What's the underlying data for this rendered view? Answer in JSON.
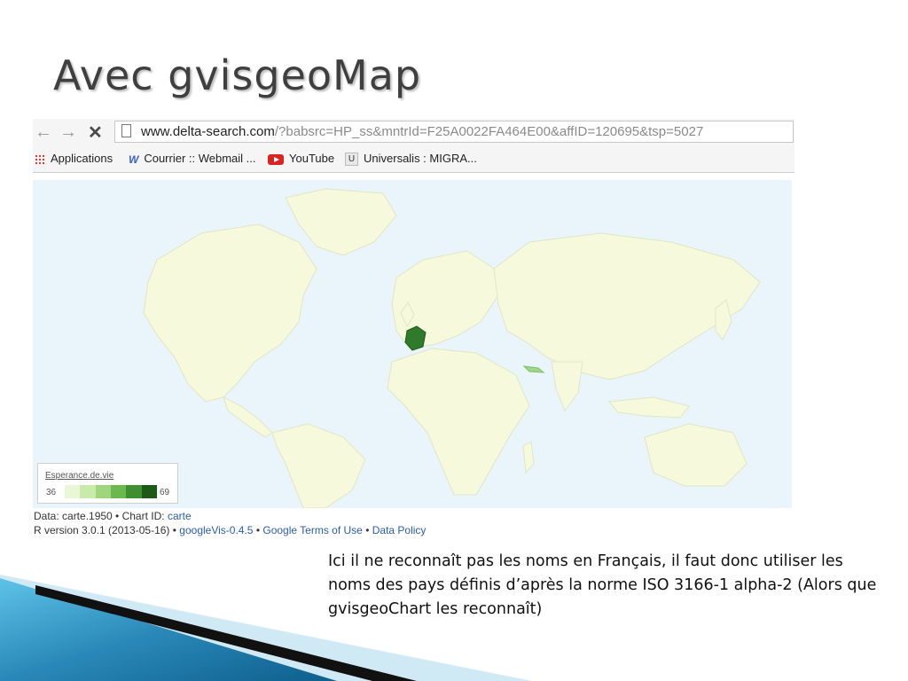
{
  "slide": {
    "title": "Avec gvisgeoMap",
    "note": "Ici il ne reconnaît pas les noms en Français, il faut donc utiliser les noms des pays définis d’après la norme ISO 3166-1 alpha-2 (Alors que gvisgeoChart les reconnaît)"
  },
  "browser": {
    "url_host": "www.delta-search.com",
    "url_rest": "/?babsrc=HP_ss&mntrId=F25A0022FA464E00&affID=120695&tsp=5027",
    "bookmarks": [
      {
        "label": "Applications",
        "icon": "apps-grid-icon"
      },
      {
        "label": "Courrier :: Webmail ...",
        "icon": "w-icon"
      },
      {
        "label": "YouTube",
        "icon": "youtube-icon"
      },
      {
        "label": "Universalis : MIGRA...",
        "icon": "u-icon"
      }
    ]
  },
  "map": {
    "legend_title": "Esperance.de.vie",
    "legend_min": "36",
    "legend_max": "69",
    "colors": {
      "ocean": "#eaf4fb",
      "land": "#f6f9dc",
      "border": "#dfe7c3",
      "france": "#2f7a2b",
      "low": "#e3f4c8",
      "high": "#1e5a17"
    }
  },
  "caption": {
    "line1_prefix": "Data: carte.1950 • Chart ID: ",
    "line1_link": "carte",
    "line2_prefix": "R version 3.0.1 (2013-05-16) • ",
    "line2_link1": "googleVis-0.4.5",
    "sep": " • ",
    "line2_link2": "Google Terms of Use",
    "line2_link3": "Data Policy"
  }
}
